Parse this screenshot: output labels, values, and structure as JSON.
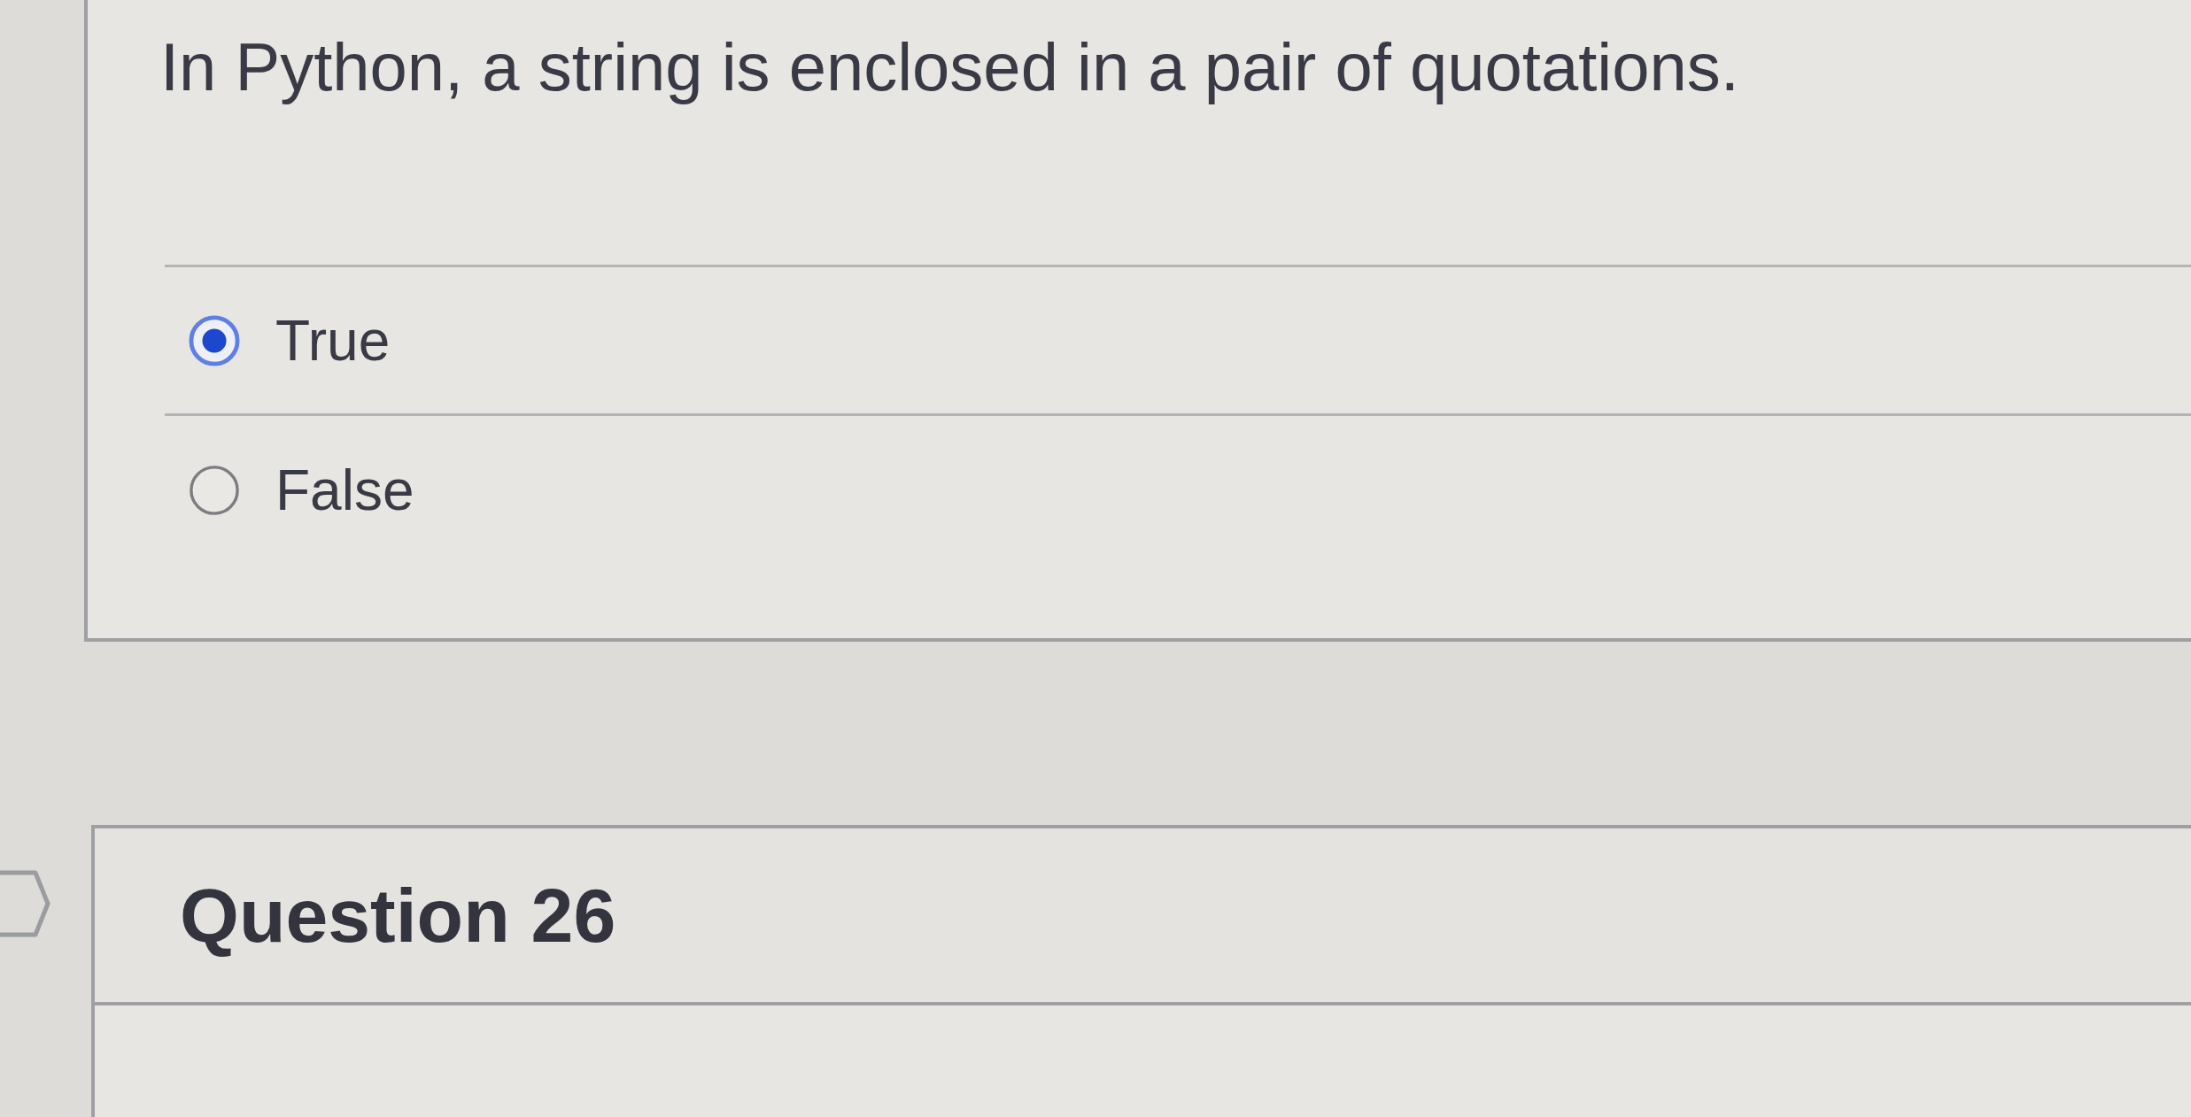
{
  "question": {
    "text": "In Python, a string is enclosed in a pair of quotations.",
    "answers": [
      {
        "label": "True",
        "selected": true
      },
      {
        "label": "False",
        "selected": false
      }
    ]
  },
  "next_question": {
    "title": "Question 26"
  }
}
